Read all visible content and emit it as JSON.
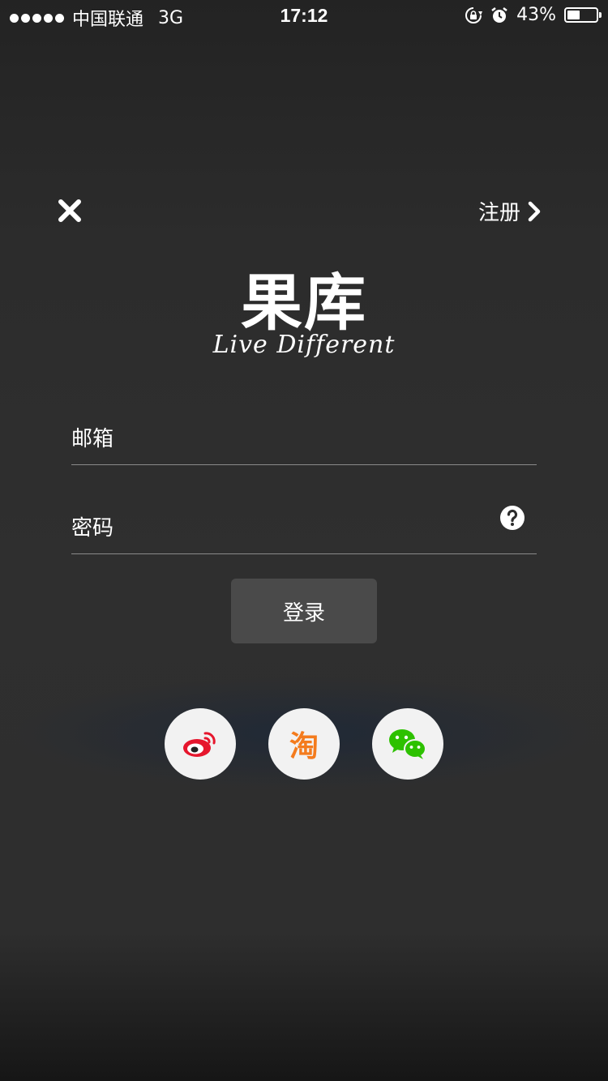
{
  "status_bar": {
    "carrier": "中国联通",
    "network": "3G",
    "time": "17:12",
    "battery": "43%",
    "battery_level": 0.43,
    "icons": [
      "rotation-lock-icon",
      "alarm-icon"
    ]
  },
  "header": {
    "close_icon": "close-icon",
    "register_label": "注册",
    "register_icon": "chevron-right-icon"
  },
  "brand": {
    "logo": "果库",
    "tagline": "Live Different"
  },
  "form": {
    "email_placeholder": "邮箱",
    "password_placeholder": "密码",
    "help_icon": "question-circle-icon",
    "login_label": "登录"
  },
  "social": [
    {
      "icon": "weibo-icon",
      "color": "#e6162d"
    },
    {
      "icon": "taobao-icon",
      "glyph": "淘",
      "color": "#f47b1d"
    },
    {
      "icon": "wechat-icon",
      "color": "#2dc100"
    }
  ]
}
